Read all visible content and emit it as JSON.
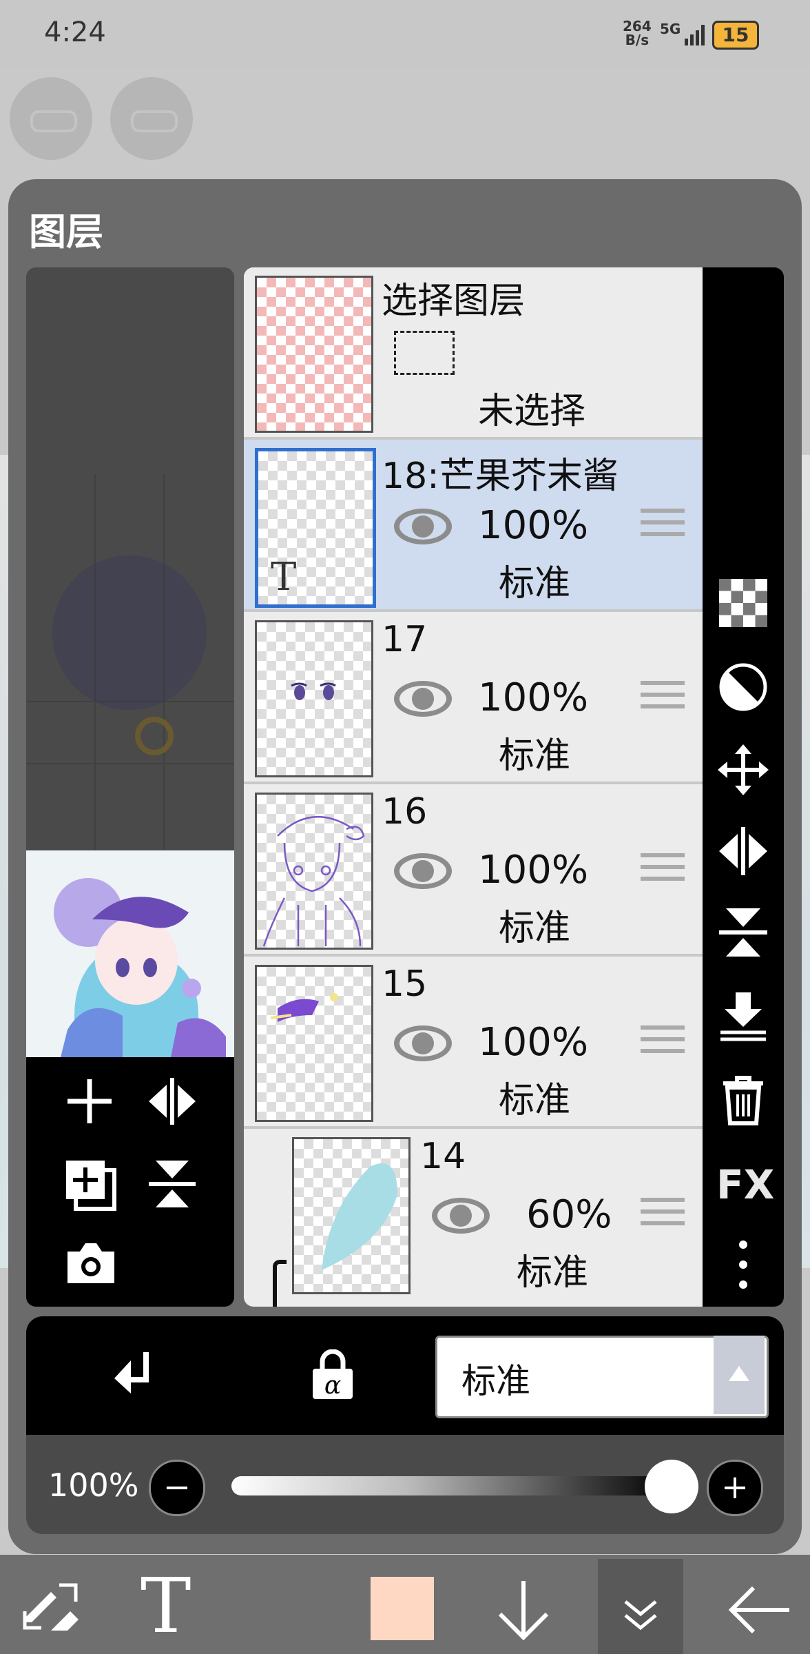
{
  "status": {
    "time": "4:24",
    "net_speed_value": "264",
    "net_speed_unit": "B/s",
    "network": "5G",
    "battery": "15"
  },
  "panel": {
    "title": "图层"
  },
  "selection_layer": {
    "title": "选择图层",
    "state": "未选择"
  },
  "layers": [
    {
      "name": "18:芒果芥末酱",
      "opacity": "100%",
      "blend": "标准",
      "selected": true,
      "type": "text"
    },
    {
      "name": "17",
      "opacity": "100%",
      "blend": "标准",
      "selected": false
    },
    {
      "name": "16",
      "opacity": "100%",
      "blend": "标准",
      "selected": false
    },
    {
      "name": "15",
      "opacity": "100%",
      "blend": "标准",
      "selected": false
    },
    {
      "name": "14",
      "opacity": "60%",
      "blend": "标准",
      "selected": false,
      "clipped": true
    }
  ],
  "text_layer_glyph": "T",
  "fx_label": "FX",
  "blend_mode": {
    "current": "标准"
  },
  "opacity": {
    "label": "100%",
    "value": 1.0
  },
  "colors": {
    "accent": "#2f6fd0",
    "selected_layer_bg": "#cfdbee",
    "current_color": "#ffd8c4"
  },
  "icons": {
    "left_tools": [
      "add-layer-icon",
      "flip-horizontal-icon",
      "duplicate-layer-icon",
      "flip-vertical-icon",
      "camera-icon"
    ],
    "right_tools": [
      "transparency-icon",
      "invert-icon",
      "move-icon",
      "flip-horizontal-icon",
      "flip-vertical-icon",
      "merge-down-icon",
      "trash-icon",
      "fx-icon",
      "more-icon"
    ],
    "toolbar": [
      "swap-tools-icon",
      "text-tool-icon",
      "color-swatch",
      "arrow-down-icon",
      "chevrons-down-icon",
      "back-arrow-icon"
    ]
  }
}
